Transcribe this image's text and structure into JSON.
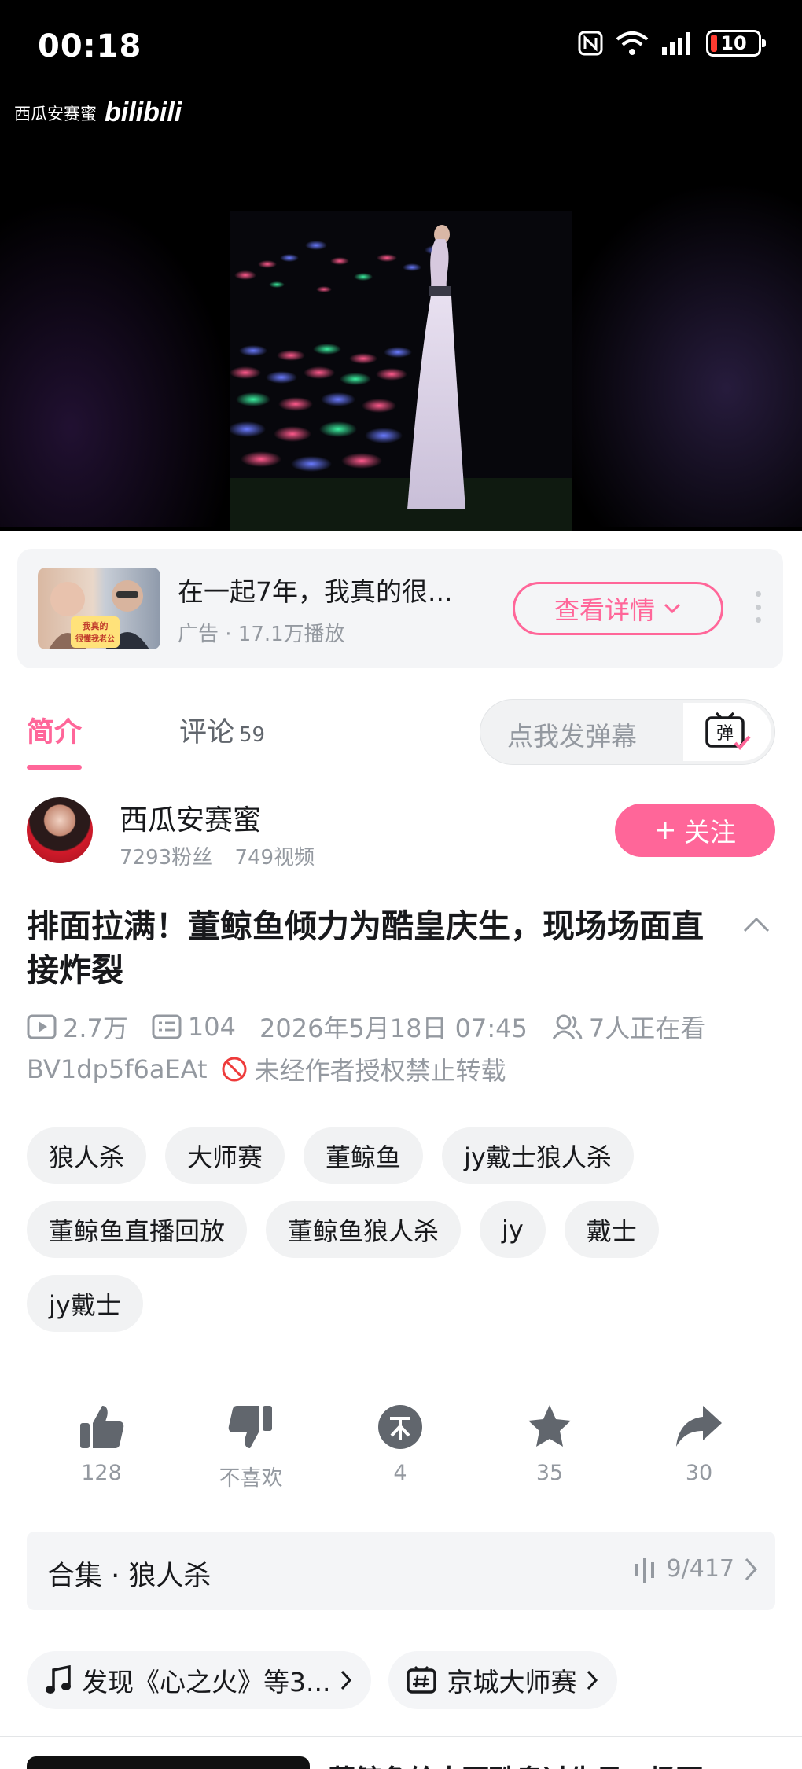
{
  "status_bar": {
    "time": "00:18",
    "battery": "10"
  },
  "video": {
    "watermark_text": "西瓜安赛蜜",
    "watermark_logo": "bilibili"
  },
  "ad": {
    "title": "在一起7年，我真的很...",
    "meta": "广告 · 17.1万播放",
    "detail_button": "查看详情",
    "thumb_tag_line1": "我真的",
    "thumb_tag_line2": "很懂我老公"
  },
  "tabs": {
    "intro": "简介",
    "comments": "评论",
    "comments_count": "59",
    "danmaku_placeholder": "点我发弹幕",
    "danmaku_icon_char": "弹"
  },
  "uploader": {
    "name": "西瓜安赛蜜",
    "fans": "7293粉丝",
    "videos": "749视频",
    "follow_label": "关注"
  },
  "video_info": {
    "title": "排面拉满！董鲸鱼倾力为酷皇庆生，现场场面直接炸裂",
    "views": "2.7万",
    "danmaku_count": "104",
    "date": "2026年5月18日 07:45",
    "watching": "7人正在看",
    "bvid": "BV1dp5f6aEAt",
    "copyright": "未经作者授权禁止转载"
  },
  "tags": [
    "狼人杀",
    "大师赛",
    "董鲸鱼",
    "jy戴士狼人杀",
    "董鲸鱼直播回放",
    "董鲸鱼狼人杀",
    "jy",
    "戴士",
    "jy戴士"
  ],
  "actions": {
    "like": "128",
    "dislike": "不喜欢",
    "coin": "4",
    "favorite": "35",
    "share": "30"
  },
  "collection": {
    "title": "合集 · 狼人杀",
    "progress": "9/417"
  },
  "bottom_chips": {
    "music": "发现《心之火》等3...",
    "topic": "京城大师赛"
  },
  "next_video": {
    "title": "董鲸鱼给太面酷皇过生日，场面"
  },
  "colors": {
    "accent": "#ff6699",
    "text": "#18191c",
    "muted": "#9499a0"
  }
}
